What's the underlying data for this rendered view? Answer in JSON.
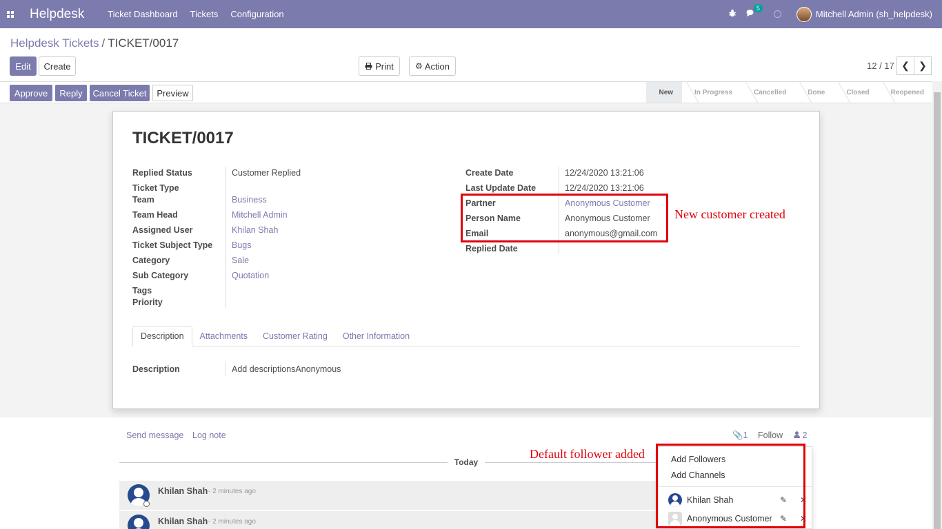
{
  "navbar": {
    "brand": "Helpdesk",
    "menu": [
      "Ticket Dashboard",
      "Tickets",
      "Configuration"
    ],
    "chat_count": "5",
    "user": "Mitchell Admin (sh_helpdesk)"
  },
  "breadcrumb": {
    "parent": "Helpdesk Tickets",
    "separator": "/",
    "current": "TICKET/0017"
  },
  "controls": {
    "edit": "Edit",
    "create": "Create",
    "print": "Print",
    "action": "Action",
    "pager": "12 / 17"
  },
  "statusbar": {
    "buttons": [
      "Approve",
      "Reply",
      "Cancel Ticket",
      "Preview"
    ],
    "stages": [
      "New",
      "In Progress",
      "Cancelled",
      "Done",
      "Closed",
      "Reopened"
    ],
    "active_stage": "New"
  },
  "ticket": {
    "title": "TICKET/0017",
    "left_fields": [
      {
        "label": "Replied Status",
        "value": "Customer Replied"
      },
      {
        "label": "Ticket Type",
        "value": ""
      },
      {
        "label": "Team",
        "value": "Business"
      },
      {
        "label": "Team Head",
        "value": "Mitchell Admin"
      },
      {
        "label": "Assigned User",
        "value": "Khilan Shah"
      },
      {
        "label": "Ticket Subject Type",
        "value": "Bugs"
      },
      {
        "label": "Category",
        "value": "Sale"
      },
      {
        "label": "Sub Category",
        "value": "Quotation"
      },
      {
        "label": "Tags",
        "value": ""
      },
      {
        "label": "Priority",
        "value": ""
      }
    ],
    "right_fields": [
      {
        "label": "Create Date",
        "value": "12/24/2020 13:21:06"
      },
      {
        "label": "Last Update Date",
        "value": "12/24/2020 13:21:06"
      },
      {
        "label": "Partner",
        "value": "Anonymous Customer"
      },
      {
        "label": "Person Name",
        "value": "Anonymous Customer"
      },
      {
        "label": "Email",
        "value": "anonymous@gmail.com"
      },
      {
        "label": "Replied Date",
        "value": ""
      }
    ],
    "tabs": [
      "Description",
      "Attachments",
      "Customer Rating",
      "Other Information"
    ],
    "description_label": "Description",
    "description_value": "Add descriptionsAnonymous"
  },
  "annotations": {
    "customer": "New customer created",
    "follower": "Default follower added"
  },
  "chatter": {
    "send_message": "Send message",
    "log_note": "Log note",
    "attachments": "1",
    "follow": "Follow",
    "followers_count": "2",
    "today": "Today",
    "messages": [
      {
        "author": "Khilan Shah",
        "time": "- 2 minutes ago"
      },
      {
        "author": "Khilan Shah",
        "time": "- 2 minutes ago"
      }
    ]
  },
  "followers_dropdown": {
    "add_followers": "Add Followers",
    "add_channels": "Add Channels",
    "followers": [
      "Khilan Shah",
      "Anonymous Customer"
    ]
  },
  "colors": {
    "brand": "#7c7bad",
    "annotation": "#e0000b",
    "badge": "#00a09d"
  }
}
